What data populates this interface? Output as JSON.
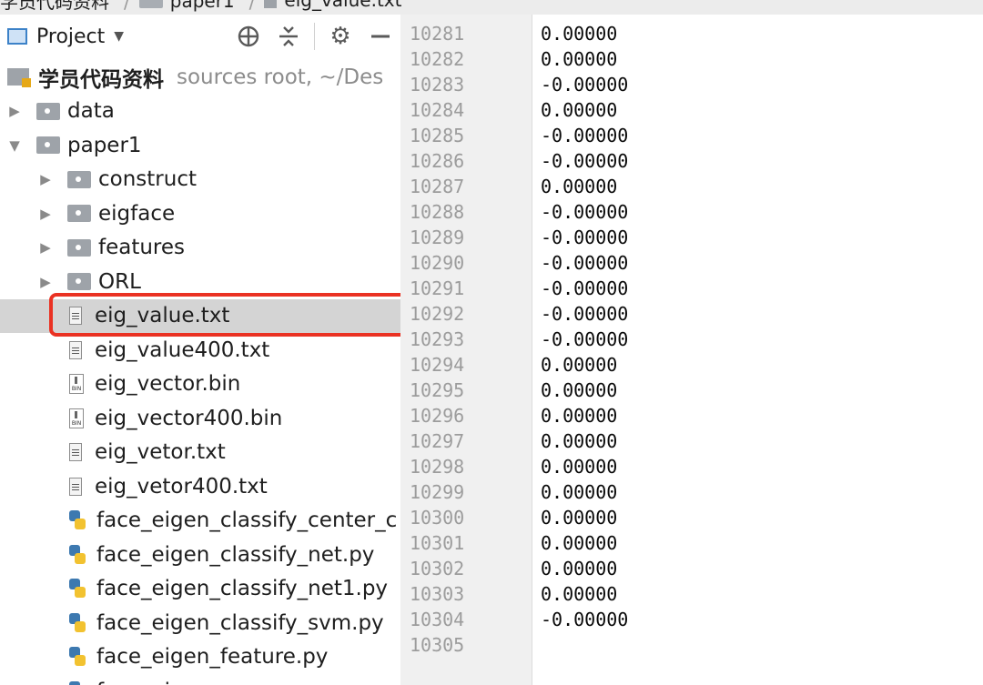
{
  "breadcrumb": {
    "items": [
      "学员代码资料",
      "paper1",
      "eig_value.txt"
    ]
  },
  "panel": {
    "title": "Project",
    "tools": [
      "crosshair-icon",
      "collapse-icon",
      "gear-icon",
      "minimize-icon"
    ]
  },
  "tree": {
    "root": {
      "label": "学员代码资料",
      "note": "sources root, ~/Des"
    },
    "items": [
      {
        "label": "data",
        "type": "folder",
        "indent": 0,
        "expanded": false
      },
      {
        "label": "paper1",
        "type": "folder",
        "indent": 0,
        "expanded": true
      },
      {
        "label": "construct",
        "type": "folder",
        "indent": 1,
        "expanded": false
      },
      {
        "label": "eigface",
        "type": "folder",
        "indent": 1,
        "expanded": false
      },
      {
        "label": "features",
        "type": "folder",
        "indent": 1,
        "expanded": false
      },
      {
        "label": "ORL",
        "type": "folder",
        "indent": 1,
        "expanded": false
      },
      {
        "label": "eig_value.txt",
        "type": "txt",
        "indent": 1,
        "selected": true
      },
      {
        "label": "eig_value400.txt",
        "type": "txt",
        "indent": 1
      },
      {
        "label": "eig_vector.bin",
        "type": "bin",
        "indent": 1
      },
      {
        "label": "eig_vector400.bin",
        "type": "bin",
        "indent": 1
      },
      {
        "label": "eig_vetor.txt",
        "type": "txt",
        "indent": 1
      },
      {
        "label": "eig_vetor400.txt",
        "type": "txt",
        "indent": 1
      },
      {
        "label": "face_eigen_classify_center_c",
        "type": "py",
        "indent": 1
      },
      {
        "label": "face_eigen_classify_net.py",
        "type": "py",
        "indent": 1
      },
      {
        "label": "face_eigen_classify_net1.py",
        "type": "py",
        "indent": 1
      },
      {
        "label": "face_eigen_classify_svm.py",
        "type": "py",
        "indent": 1
      },
      {
        "label": "face_eigen_feature.py",
        "type": "py",
        "indent": 1
      },
      {
        "label": "face_eigen_pca.py",
        "type": "py",
        "indent": 1
      }
    ]
  },
  "editor": {
    "lines": [
      {
        "n": "10281",
        "v": "0.00000"
      },
      {
        "n": "10282",
        "v": "0.00000"
      },
      {
        "n": "10283",
        "v": "-0.00000"
      },
      {
        "n": "10284",
        "v": "0.00000"
      },
      {
        "n": "10285",
        "v": "-0.00000"
      },
      {
        "n": "10286",
        "v": "-0.00000"
      },
      {
        "n": "10287",
        "v": "0.00000"
      },
      {
        "n": "10288",
        "v": "-0.00000"
      },
      {
        "n": "10289",
        "v": "-0.00000"
      },
      {
        "n": "10290",
        "v": "-0.00000"
      },
      {
        "n": "10291",
        "v": "-0.00000"
      },
      {
        "n": "10292",
        "v": "-0.00000"
      },
      {
        "n": "10293",
        "v": "-0.00000"
      },
      {
        "n": "10294",
        "v": "0.00000"
      },
      {
        "n": "10295",
        "v": "0.00000"
      },
      {
        "n": "10296",
        "v": "0.00000"
      },
      {
        "n": "10297",
        "v": "0.00000"
      },
      {
        "n": "10298",
        "v": "0.00000"
      },
      {
        "n": "10299",
        "v": "0.00000"
      },
      {
        "n": "10300",
        "v": "0.00000"
      },
      {
        "n": "10301",
        "v": "0.00000"
      },
      {
        "n": "10302",
        "v": "0.00000"
      },
      {
        "n": "10303",
        "v": "0.00000"
      },
      {
        "n": "10304",
        "v": "-0.00000"
      },
      {
        "n": "10305",
        "v": ""
      }
    ]
  },
  "colors": {
    "highlight": "#ea3223",
    "selected_row": "#d4d4d4",
    "gutter": "#f0f0f0"
  }
}
